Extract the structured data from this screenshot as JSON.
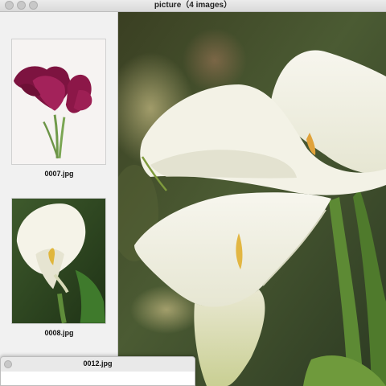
{
  "window": {
    "title": "picture（4 images）"
  },
  "sidebar": {
    "items": [
      {
        "filename": "0007.jpg",
        "subject": "purple calla lily on white background"
      },
      {
        "filename": "0008.jpg",
        "subject": "white calla lily on green background"
      }
    ]
  },
  "sub_window": {
    "title": "0012.jpg"
  },
  "colors": {
    "titlebar": "#dcdcdc",
    "sidebar": "#f1f1f1",
    "purple_petal": "#8a1746",
    "calla_white": "#f4f2e6",
    "foliage": "#2f4a22",
    "stamen": "#e0b63c"
  }
}
